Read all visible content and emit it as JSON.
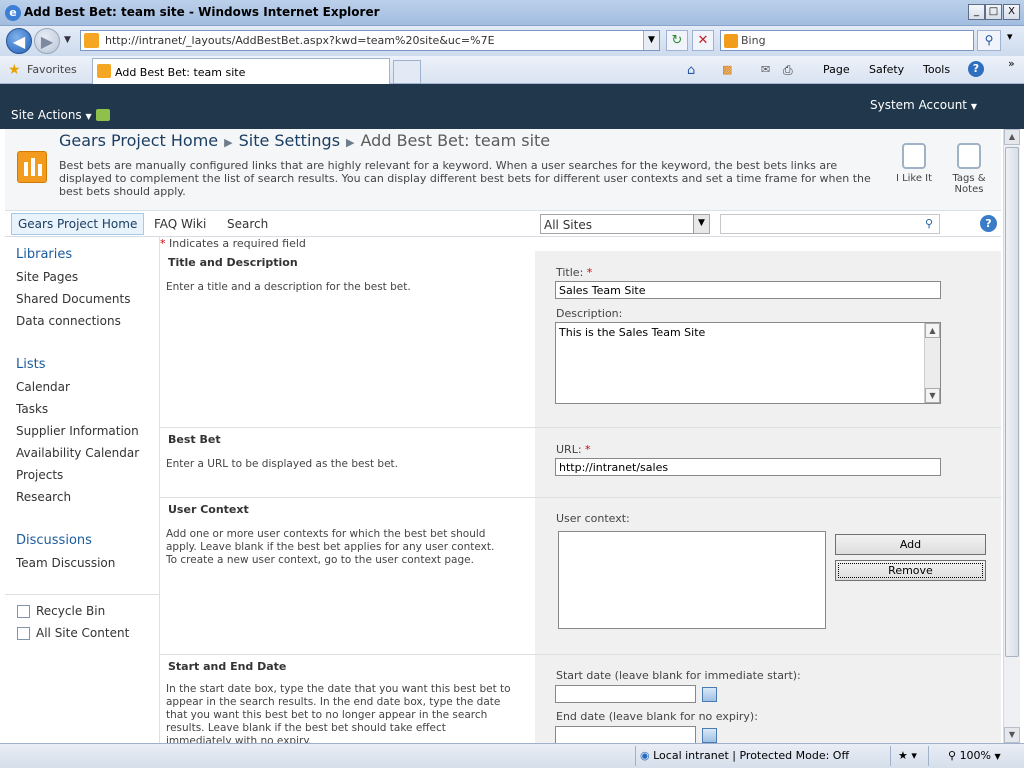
{
  "window": {
    "title": "Add Best Bet: team site - Windows Internet Explorer",
    "buttons": {
      "minimize": "_",
      "maximize": "□",
      "close": "X"
    }
  },
  "browser": {
    "url": "http://intranet/_layouts/AddBestBet.aspx?kwd=team%20site&uc=%7E",
    "search_placeholder": "Bing",
    "favorites_label": "Favorites",
    "tab_title": "Add Best Bet: team site",
    "toolbar": {
      "page": "Page",
      "safety": "Safety",
      "tools": "Tools",
      "overflow": "»"
    },
    "status": {
      "zone": "Local intranet | Protected Mode: Off",
      "zoom": "100%"
    }
  },
  "sharepoint": {
    "site_actions": "Site Actions",
    "user": "System Account",
    "breadcrumb": [
      "Gears Project Home",
      "Site Settings",
      "Add Best Bet: team site"
    ],
    "description": "Best bets are manually configured links that are highly relevant for a keyword. When a user searches for the keyword, the best bets links are displayed to complement the list of search results. You can display different best bets for different user contexts and set a time frame for when the best bets should apply.",
    "social": {
      "like": "I Like It",
      "tags": "Tags & Notes"
    },
    "top_nav": [
      "Gears Project Home",
      "FAQ Wiki",
      "Search"
    ],
    "search_scope": "All Sites",
    "help": "?"
  },
  "left_nav": {
    "libraries": {
      "heading": "Libraries",
      "items": [
        "Site Pages",
        "Shared Documents",
        "Data connections"
      ]
    },
    "lists": {
      "heading": "Lists",
      "items": [
        "Calendar",
        "Tasks",
        "Supplier Information",
        "Availability Calendar",
        "Projects",
        "Research"
      ]
    },
    "discussions": {
      "heading": "Discussions",
      "items": [
        "Team Discussion"
      ]
    },
    "footer": [
      "Recycle Bin",
      "All Site Content"
    ]
  },
  "form": {
    "required_note": "Indicates a required field",
    "required_mark": "*",
    "sections": {
      "title_desc": {
        "heading": "Title and Description",
        "help": "Enter a title and a description for the best bet.",
        "title_label": "Title:",
        "title_value": "Sales Team Site",
        "desc_label": "Description:",
        "desc_value": "This is the Sales Team Site"
      },
      "best_bet": {
        "heading": "Best Bet",
        "help": "Enter a URL to be displayed as the best bet.",
        "url_label": "URL:",
        "url_value": "http://intranet/sales"
      },
      "user_context": {
        "heading": "User Context",
        "help": "Add one or more user contexts for which the best bet should apply. Leave blank if the best bet applies for any user context. To create a new user context, go to the user context page.",
        "label": "User context:",
        "add": "Add",
        "remove": "Remove"
      },
      "dates": {
        "heading": "Start and End Date",
        "help": "In the start date box, type the date that you want this best bet to appear in the search results. In the end date box, type the date that you want this best bet to no longer appear in the search results. Leave blank if the best bet should take effect immediately with no expiry.",
        "start_label": "Start date (leave blank for immediate start):",
        "end_label": "End date (leave blank for no expiry):"
      }
    }
  }
}
